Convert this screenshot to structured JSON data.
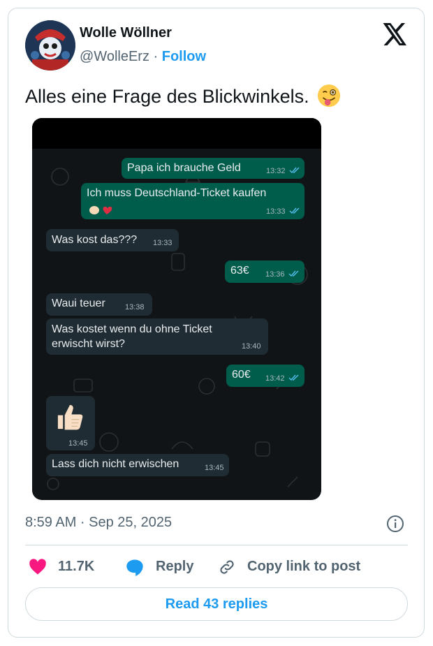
{
  "author": {
    "name": "Wolle Wöllner",
    "handle": "@WolleErz",
    "separator": "·",
    "follow_label": "Follow",
    "avatar_icon": "profile-avatar"
  },
  "post": {
    "text": "Alles eine Frage des Blickwinkels.",
    "emoji_icon": "winking-face-with-tongue",
    "timestamp": "8:59 AM · Sep 25, 2025"
  },
  "chat": {
    "messages": [
      {
        "direction": "outgoing",
        "text": "Papa ich brauche Geld",
        "time": "13:32"
      },
      {
        "direction": "outgoing",
        "text": "Ich muss Deutschland-Ticket kaufen",
        "reactions": "clapping-hands, red-heart",
        "time": "13:33"
      },
      {
        "direction": "incoming",
        "text": "Was kost das???",
        "time": "13:33"
      },
      {
        "direction": "outgoing",
        "text": "63€",
        "time": "13:36"
      },
      {
        "direction": "incoming",
        "text": "Waui teuer",
        "time": "13:38"
      },
      {
        "direction": "incoming",
        "text_line1": "Was kostet wenn du ohne Ticket",
        "text_line2": "erwischt wirst?",
        "time": "13:40"
      },
      {
        "direction": "outgoing",
        "text": "60€",
        "time": "13:42"
      },
      {
        "direction": "incoming",
        "sticker_icon": "thumbs-up",
        "time": "13:45"
      },
      {
        "direction": "incoming",
        "text": "Lass dich nicht erwischen",
        "time": "13:45"
      }
    ],
    "outgoing_color": "#005c4b",
    "incoming_color": "#202c33"
  },
  "actions": {
    "like_count": "11.7K",
    "reply_label": "Reply",
    "copy_label": "Copy link to post",
    "read_replies_label": "Read 43 replies"
  },
  "colors": {
    "accent": "#1d9bf0",
    "like": "#f91880",
    "muted": "#536471"
  }
}
